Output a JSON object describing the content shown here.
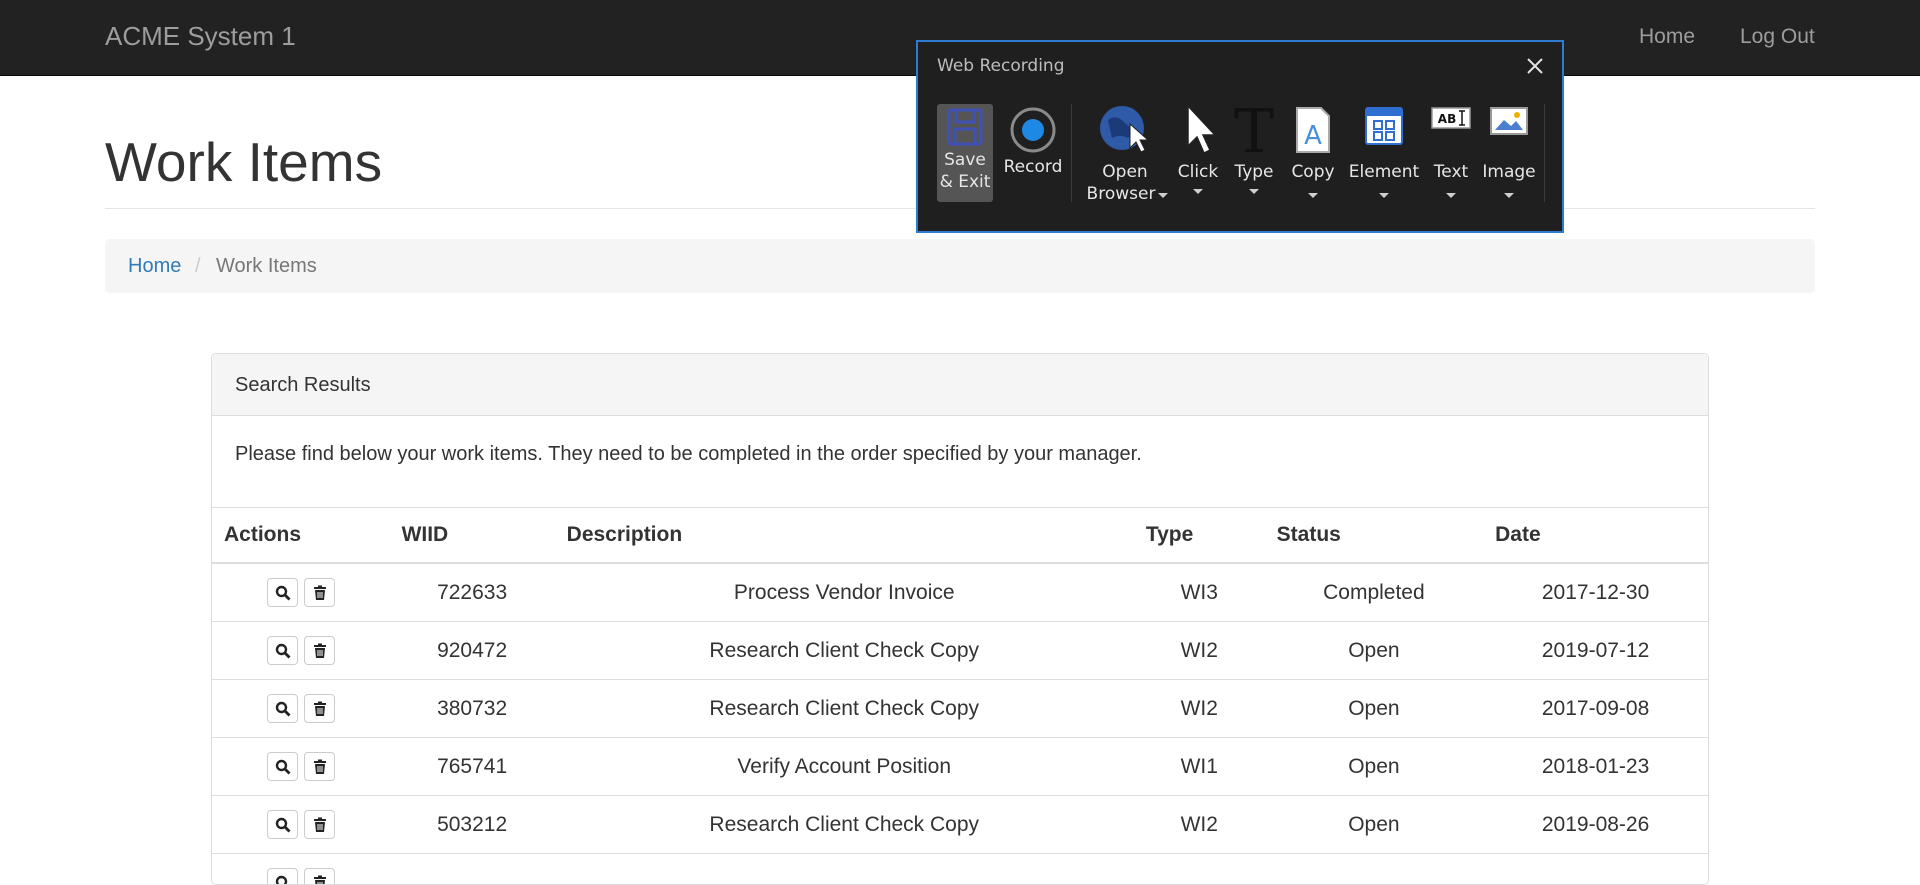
{
  "navbar": {
    "brand": "ACME System 1",
    "links": {
      "home": "Home",
      "logout": "Log Out"
    }
  },
  "page": {
    "title": "Work Items"
  },
  "breadcrumb": {
    "home": "Home",
    "separator": "/",
    "current": "Work Items"
  },
  "panel": {
    "title": "Search Results",
    "body": "Please find below your work items. They need to be completed in the order specified by your manager."
  },
  "table": {
    "headers": {
      "actions": "Actions",
      "wiid": "WIID",
      "description": "Description",
      "type": "Type",
      "status": "Status",
      "date": "Date"
    },
    "rows": [
      {
        "wiid": "722633",
        "description": "Process Vendor Invoice",
        "type": "WI3",
        "status": "Completed",
        "date": "2017-12-30"
      },
      {
        "wiid": "920472",
        "description": "Research Client Check Copy",
        "type": "WI2",
        "status": "Open",
        "date": "2019-07-12"
      },
      {
        "wiid": "380732",
        "description": "Research Client Check Copy",
        "type": "WI2",
        "status": "Open",
        "date": "2017-09-08"
      },
      {
        "wiid": "765741",
        "description": "Verify Account Position",
        "type": "WI1",
        "status": "Open",
        "date": "2018-01-23"
      },
      {
        "wiid": "503212",
        "description": "Research Client Check Copy",
        "type": "WI2",
        "status": "Open",
        "date": "2019-08-26"
      },
      {
        "wiid": "",
        "description": "",
        "type": "",
        "status": "",
        "date": ""
      }
    ],
    "row_icons": [
      "search-icon",
      "trash-icon"
    ]
  },
  "recorder": {
    "title": "Web Recording",
    "tools": {
      "save_line1": "Save",
      "save_line2": "& Exit",
      "record": "Record",
      "open_line1": "Open",
      "open_line2": "Browser",
      "click": "Click",
      "type": "Type",
      "copy": "Copy",
      "element": "Element",
      "text": "Text",
      "image": "Image"
    },
    "colors": {
      "accent": "#2e7bd4",
      "record": "#1e88e5",
      "background": "#1f1f1f"
    }
  }
}
